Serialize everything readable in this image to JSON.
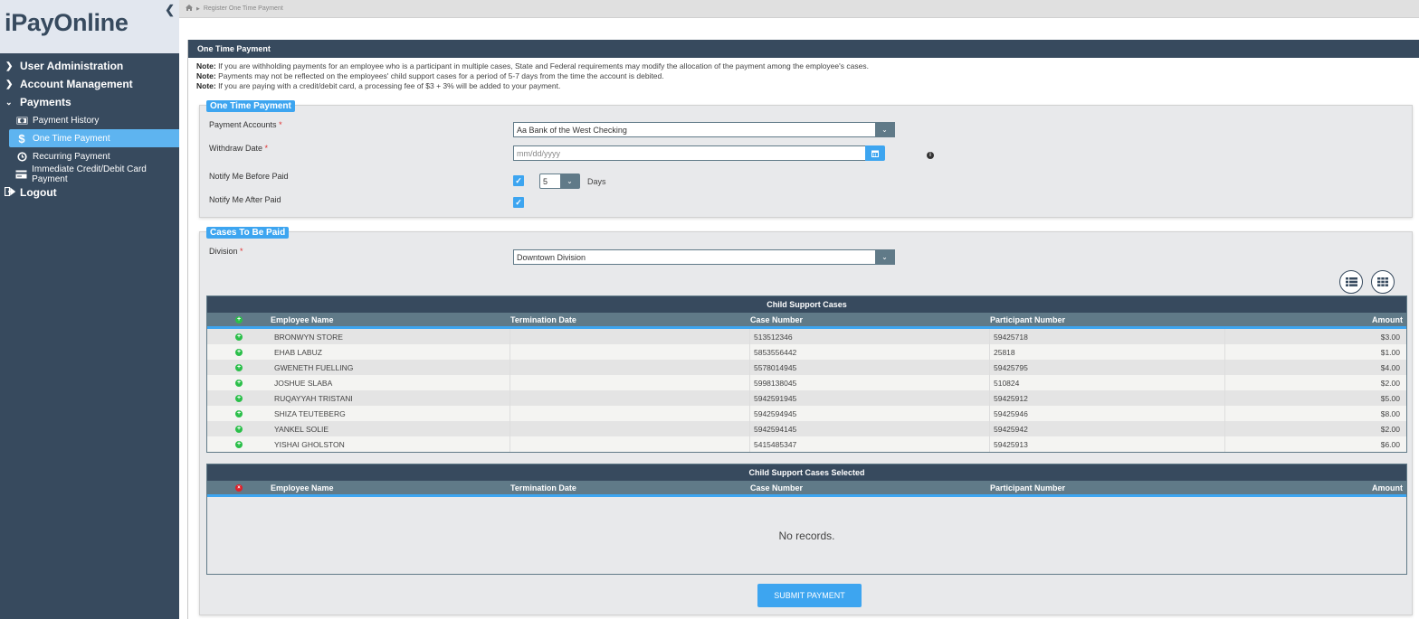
{
  "app": {
    "title": "iPayOnline"
  },
  "sidebar": {
    "items": [
      {
        "label": "User Administration",
        "icon": "chevron-right-icon",
        "expanded": false
      },
      {
        "label": "Account Management",
        "icon": "chevron-right-icon",
        "expanded": false
      },
      {
        "label": "Payments",
        "icon": "chevron-down-icon",
        "expanded": true,
        "children": [
          {
            "label": "Payment History",
            "icon": "money-icon",
            "active": false
          },
          {
            "label": "One Time Payment",
            "icon": "dollar-icon",
            "active": true
          },
          {
            "label": "Recurring Payment",
            "icon": "clock-icon",
            "active": false
          },
          {
            "label": "Immediate Credit/Debit Card Payment",
            "icon": "credit-card-icon",
            "active": false
          }
        ]
      },
      {
        "label": "Logout",
        "icon": "sign-out-icon"
      }
    ]
  },
  "breadcrumb": {
    "home_icon": "home-icon",
    "current": "Register One Time Payment"
  },
  "panel": {
    "title": "One Time Payment",
    "notes": [
      {
        "prefix": "Note:",
        "text": " If you are withholding payments for an employee who is a participant in multiple cases, State and Federal requirements may modify the allocation of the payment among the employee's cases."
      },
      {
        "prefix": "Note:",
        "text": " Payments may not be reflected on the employees' child support cases for a period of 5-7 days from the time the account is debited."
      },
      {
        "prefix": "Note:",
        "text": " If you are paying with a credit/debit card, a processing fee of $3 + 3% will be added to your payment."
      }
    ]
  },
  "payment_form": {
    "legend": "One Time Payment",
    "payment_accounts_label": "Payment Accounts",
    "payment_accounts_value": "Aa Bank of the West Checking",
    "withdraw_date_label": "Withdraw Date",
    "withdraw_date_value": "",
    "withdraw_date_placeholder": "mm/dd/yyyy",
    "notify_before_label": "Notify Me Before Paid",
    "notify_before_checked": true,
    "notify_days_value": "5",
    "notify_days_unit": "Days",
    "notify_after_label": "Notify Me After Paid",
    "notify_after_checked": true,
    "required_mark": "*"
  },
  "cases": {
    "legend": "Cases To Be Paid",
    "division_label": "Division",
    "division_value": "Downtown Division",
    "view_buttons": [
      "list-view-icon",
      "grid-view-icon"
    ],
    "table": {
      "title": "Child Support Cases",
      "columns": [
        "Employee Name",
        "Termination Date",
        "Case Number",
        "Participant Number",
        "Amount"
      ],
      "rows": [
        {
          "name": "BRONWYN STORE",
          "termination": "",
          "case": "513512346",
          "participant": "59425718",
          "amount": "$3.00"
        },
        {
          "name": "EHAB LABUZ",
          "termination": "",
          "case": "5853556442",
          "participant": "25818",
          "amount": "$1.00"
        },
        {
          "name": "GWENETH FUELLING",
          "termination": "",
          "case": "5578014945",
          "participant": "59425795",
          "amount": "$4.00"
        },
        {
          "name": "JOSHUE SLABA",
          "termination": "",
          "case": "5998138045",
          "participant": "510824",
          "amount": "$2.00"
        },
        {
          "name": "RUQAYYAH TRISTANI",
          "termination": "",
          "case": "5942591945",
          "participant": "59425912",
          "amount": "$5.00"
        },
        {
          "name": "SHIZA TEUTEBERG",
          "termination": "",
          "case": "5942594945",
          "participant": "59425946",
          "amount": "$8.00"
        },
        {
          "name": "YANKEL SOLIE",
          "termination": "",
          "case": "5942594145",
          "participant": "59425942",
          "amount": "$2.00"
        },
        {
          "name": "YISHAI GHOLSTON",
          "termination": "",
          "case": "5415485347",
          "participant": "59425913",
          "amount": "$6.00"
        }
      ]
    },
    "selected_table": {
      "title": "Child Support Cases Selected",
      "columns": [
        "Employee Name",
        "Termination Date",
        "Case Number",
        "Participant Number",
        "Amount"
      ],
      "empty_text": "No records."
    },
    "submit_label": "SUBMIT PAYMENT"
  }
}
